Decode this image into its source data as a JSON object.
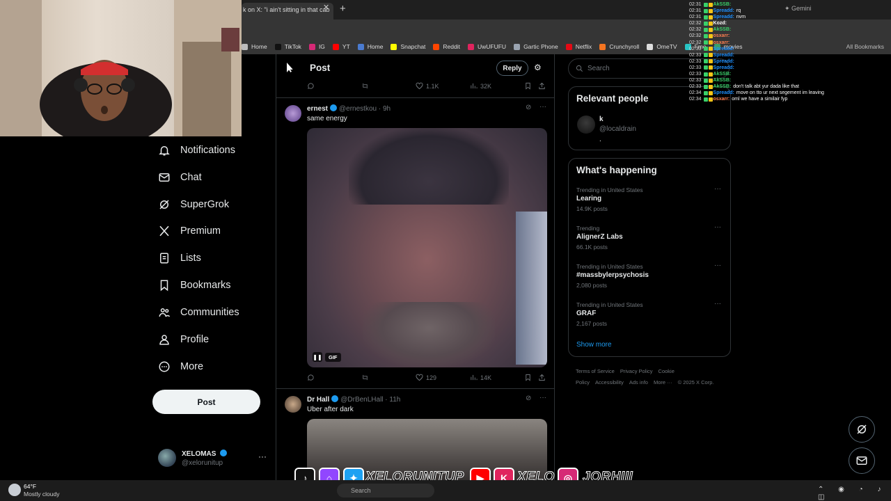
{
  "browser": {
    "tab_title": "k on X: \"i ain't sitting in that cab",
    "assistant_label": "Gemini",
    "bookmarks": [
      {
        "label": "Home",
        "color": "#bbbbbb"
      },
      {
        "label": "TikTok",
        "color": "#111111"
      },
      {
        "label": "IG",
        "color": "#d62976"
      },
      {
        "label": "YT",
        "color": "#ff0000"
      },
      {
        "label": "Home",
        "color": "#4a7bd0"
      },
      {
        "label": "Snapchat",
        "color": "#fffc00"
      },
      {
        "label": "Reddit",
        "color": "#ff4500"
      },
      {
        "label": "UwUFUFU",
        "color": "#e0245e"
      },
      {
        "label": "Gartic Phone",
        "color": "#9aa4b1"
      },
      {
        "label": "Netflix",
        "color": "#e50914"
      },
      {
        "label": "Crunchyroll",
        "color": "#f47521"
      },
      {
        "label": "OmeTV",
        "color": "#dddddd"
      },
      {
        "label": "Fmo",
        "color": "#27c4c4"
      },
      {
        "label": "movies",
        "color": "#3aa16b"
      }
    ],
    "all_bookmarks": "All Bookmarks"
  },
  "nav": {
    "items": [
      {
        "label": "Notifications",
        "icon": "bell-icon"
      },
      {
        "label": "Chat",
        "icon": "mail-icon"
      },
      {
        "label": "SuperGrok",
        "icon": "grok-icon"
      },
      {
        "label": "Premium",
        "icon": "x-logo-icon"
      },
      {
        "label": "Lists",
        "icon": "list-icon"
      },
      {
        "label": "Bookmarks",
        "icon": "bookmark-icon"
      },
      {
        "label": "Communities",
        "icon": "people-icon"
      },
      {
        "label": "Profile",
        "icon": "person-icon"
      },
      {
        "label": "More",
        "icon": "more-circle-icon"
      }
    ],
    "post_button": "Post",
    "account": {
      "name": "XELOMAS",
      "handle": "@xelorunitup",
      "more": "···"
    }
  },
  "center": {
    "header_title": "Post",
    "reply_button": "Reply",
    "top_actions": {
      "likes": "1.1K",
      "views": "32K"
    },
    "tweets": [
      {
        "name": "ernest",
        "handle": "@ernestkou · 9h",
        "text": "same energy",
        "media_badge": "GIF",
        "actions": {
          "likes": "129",
          "views": "14K"
        }
      },
      {
        "name": "Dr Hall",
        "handle": "@DrBenLHall · 11h",
        "text": "Uber after dark"
      }
    ]
  },
  "right": {
    "search_placeholder": "Search",
    "relevant_people_title": "Relevant people",
    "person": {
      "name": "k",
      "handle": "@localdrain",
      "bio": "."
    },
    "happening_title": "What's happening",
    "trends": [
      {
        "context": "Trending in United States",
        "name": "Learing",
        "count": "14.9K posts"
      },
      {
        "context": "Trending",
        "name": "AlignerZ Labs",
        "count": "66.1K posts"
      },
      {
        "context": "Trending in United States",
        "name": "#massbylerpsychosis",
        "count": "2,080 posts"
      },
      {
        "context": "Trending in United States",
        "name": "GRAF",
        "count": "2,167 posts"
      }
    ],
    "show_more": "Show more",
    "footer": [
      "Terms of Service",
      "Privacy Policy",
      "Cookie Policy",
      "Accessibility",
      "Ads info",
      "More ···",
      "© 2025 X Corp."
    ]
  },
  "chat": [
    {
      "time": "02:31",
      "user": "AkSSB:",
      "color": "#3ad06a",
      "msg": ""
    },
    {
      "time": "02:31",
      "user": "Spreadd:",
      "color": "#1e90ff",
      "msg": "rq"
    },
    {
      "time": "02:31",
      "user": "Spreadd:",
      "color": "#1e90ff",
      "msg": "nvm"
    },
    {
      "time": "02:32",
      "user": "Kozd:",
      "color": "#ffffff",
      "msg": ""
    },
    {
      "time": "02:32",
      "user": "AkSSB:",
      "color": "#3ad06a",
      "msg": ""
    },
    {
      "time": "02:32",
      "user": "osxarr:",
      "color": "#ff7f50",
      "msg": ""
    },
    {
      "time": "02:32",
      "user": "osxarr:",
      "color": "#ff7f50",
      "msg": ""
    },
    {
      "time": "02:33",
      "user": "Spreadd:",
      "color": "#1e90ff",
      "msg": ""
    },
    {
      "time": "02:33",
      "user": "Spreadd:",
      "color": "#1e90ff",
      "msg": ""
    },
    {
      "time": "02:33",
      "user": "Spreadd:",
      "color": "#1e90ff",
      "msg": ""
    },
    {
      "time": "02:33",
      "user": "Spreadd:",
      "color": "#1e90ff",
      "msg": ""
    },
    {
      "time": "02:33",
      "user": "AkSSB:",
      "color": "#3ad06a",
      "msg": ""
    },
    {
      "time": "02:33",
      "user": "AkSSB:",
      "color": "#3ad06a",
      "msg": ""
    },
    {
      "time": "02:33",
      "user": "AkSSB:",
      "color": "#3ad06a",
      "msg": "don't talk abt yur dada like that"
    },
    {
      "time": "02:34",
      "user": "Spreadd:",
      "color": "#1e90ff",
      "msg": "move on tto ur next segement im leaving"
    },
    {
      "time": "02:34",
      "user": "osxarr:",
      "color": "#ff7f50",
      "msg": "oml we have a similair fyp"
    }
  ],
  "social": {
    "handle1": "XELORUNITUP",
    "handle2": "XELO",
    "handle3": "JORHIII"
  },
  "taskbar": {
    "temp": "64°F",
    "weather": "Mostly cloudy",
    "search": "Search"
  }
}
